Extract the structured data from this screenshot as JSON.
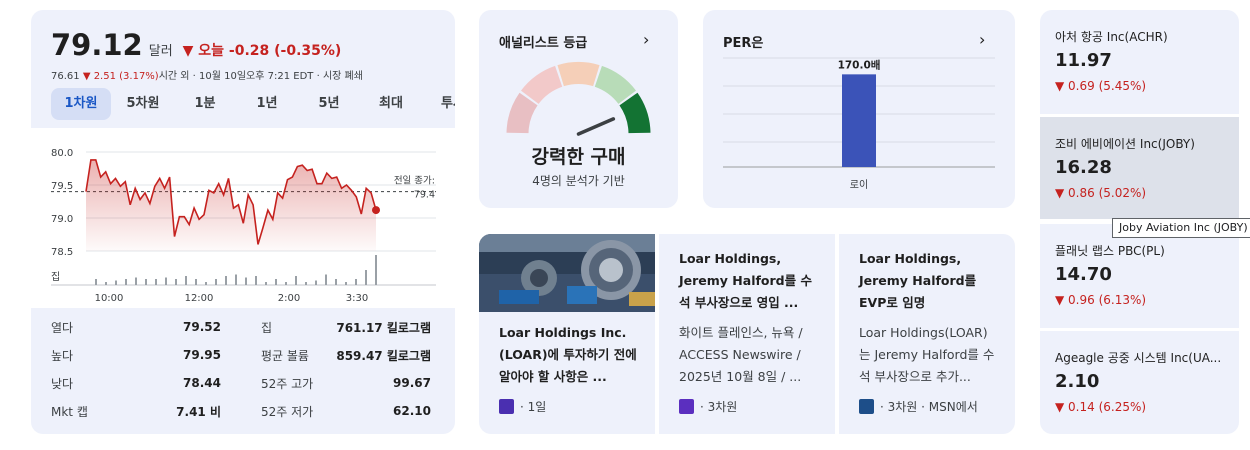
{
  "quote": {
    "price": "79.12",
    "currency": "달러",
    "change_today": "▼ 오늘 -0.28 (-0.35%)",
    "prev_value": "76.61",
    "after_change": "▼ 2.51 (3.17%)",
    "after_label": "시간 외 · 10월 10일오후 7:21 EDT · 시장 폐쇄",
    "tabs": [
      "1차원",
      "5차원",
      "1분",
      "1년",
      "5년",
      "최대",
      "투사"
    ],
    "active_tab": "1차원",
    "prev_close_label": "전일 종가:",
    "prev_close_value": "79.4",
    "volume_label": "집",
    "stats_left": [
      {
        "label": "열다",
        "value": "79.52"
      },
      {
        "label": "높다",
        "value": "79.95"
      },
      {
        "label": "낮다",
        "value": "78.44"
      },
      {
        "label": "Mkt 캡",
        "value": "7.41 비"
      }
    ],
    "stats_right": [
      {
        "label": "집",
        "value": "761.17 킬로그램"
      },
      {
        "label": "평균 볼륨",
        "value": "859.47 킬로그램"
      },
      {
        "label": "52주 고가",
        "value": "99.67"
      },
      {
        "label": "52주 저가",
        "value": "62.10"
      }
    ]
  },
  "chart_data": {
    "type": "line",
    "x_ticks": [
      "10:00",
      "12:00",
      "2:00",
      "3:30"
    ],
    "y_ticks": [
      "80.0",
      "79.5",
      "79.0",
      "78.5"
    ],
    "ylim": [
      78.5,
      80.0
    ],
    "prev_close": 79.4,
    "price_series": [
      79.4,
      79.88,
      79.88,
      79.62,
      79.7,
      79.52,
      79.6,
      79.48,
      79.55,
      79.2,
      79.45,
      79.28,
      79.38,
      79.22,
      79.48,
      79.6,
      79.45,
      79.62,
      78.72,
      79.02,
      79.02,
      78.9,
      79.15,
      78.98,
      79.05,
      79.42,
      79.38,
      79.52,
      79.35,
      79.6,
      79.15,
      79.2,
      78.92,
      79.35,
      79.2,
      78.6,
      78.85,
      79.12,
      78.98,
      79.38,
      79.3,
      79.58,
      79.62,
      79.78,
      79.8,
      79.72,
      79.74,
      79.52,
      79.52,
      79.68,
      79.6,
      79.62,
      79.45,
      79.5,
      79.42,
      79.32,
      79.06,
      79.45,
      79.38,
      79.12
    ],
    "volumes": [
      0.2,
      0.1,
      0.15,
      0.2,
      0.25,
      0.2,
      0.2,
      0.25,
      0.2,
      0.3,
      0.2,
      0.1,
      0.2,
      0.3,
      0.35,
      0.25,
      0.3,
      0.1,
      0.2,
      0.1,
      0.3,
      0.1,
      0.15,
      0.35,
      0.2,
      0.1,
      0.2,
      0.5,
      1.0
    ],
    "line_color": "#c5221f"
  },
  "analyst": {
    "title": "애널리스트 등급",
    "rating": "강력한 구매",
    "subtitle": "4명의 분석가 기반",
    "gauge_colors": [
      "#e8bfc3",
      "#f2c9c9",
      "#f5cfb8",
      "#b8dcb8",
      "#137333"
    ],
    "active_segment": 4
  },
  "per": {
    "title": "PER은",
    "bar_value": 170.0,
    "bar_label": "170.0배",
    "category": "로이",
    "ylim": [
      0,
      200
    ],
    "bar_color": "#3b53b8"
  },
  "news": [
    {
      "title": "Loar Holdings Inc. (LOAR)에 투자하기 전에 알아야 할 사항은 ...",
      "meta": "· 1일",
      "source_color": "#4a2fb0"
    },
    {
      "title": "Loar Holdings, Jeremy Halford를 수석 부사장으로 영입 ...",
      "snippet": "화이트 플레인스, 뉴욕 / ACCESS Newswire / 2025년 10월 8일 / ...",
      "meta": "· 3차원",
      "source_color": "#5b2fbf"
    },
    {
      "title": "Loar Holdings, Jeremy Halford를 EVP로 임명",
      "snippet": "Loar Holdings(LOAR)는 Jeremy Halford를 수석 부사장으로 추가...",
      "meta": "· 3차원 · MSN에서",
      "source_color": "#1d4e89"
    }
  ],
  "related": [
    {
      "name": "아처 항공 Inc(ACHR)",
      "price": "11.97",
      "change": "▼ 0.69 (5.45%)"
    },
    {
      "name": "조비 에비에이션 Inc(JOBY)",
      "price": "16.28",
      "change": "▼ 0.86 (5.02%)"
    },
    {
      "name": "플래닛 랩스 PBC(PL)",
      "price": "14.70",
      "change": "▼ 0.96 (6.13%)"
    },
    {
      "name": "Ageagle 공중 시스템 Inc(UA...",
      "price": "2.10",
      "change": "▼ 0.14 (6.25%)"
    }
  ],
  "tooltip": "Joby Aviation Inc (JOBY)"
}
